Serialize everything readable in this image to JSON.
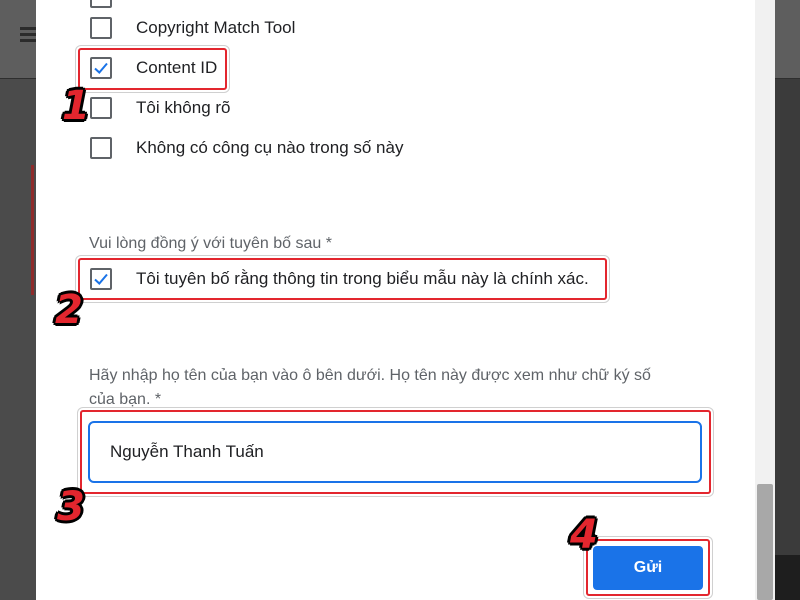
{
  "options": [
    {
      "label": "Copyright Match Tool",
      "checked": false
    },
    {
      "label": "Content ID",
      "checked": true
    },
    {
      "label": "Tôi không rõ",
      "checked": false
    },
    {
      "label": "Không có công cụ nào trong số này",
      "checked": false
    }
  ],
  "declaration": {
    "question": "Vui lòng đồng ý với tuyên bố sau *",
    "label": "Tôi tuyên bố rằng thông tin trong biểu mẫu này là chính xác.",
    "checked": true
  },
  "signature": {
    "line1": "Hãy nhập họ tên của bạn vào ô bên dưới. Họ tên này được xem như chữ ký số",
    "line2": "của bạn. *",
    "value": "Nguyễn Thanh Tuấn"
  },
  "submit_label": "Gửi",
  "steps": [
    "1",
    "2",
    "3",
    "4"
  ],
  "colors": {
    "accent": "#1a73e8",
    "annotation": "#e3262e"
  }
}
